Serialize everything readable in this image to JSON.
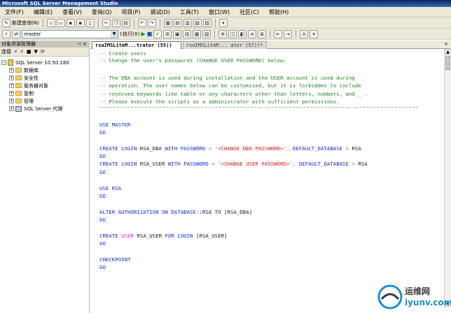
{
  "window": {
    "title": "Microsoft SQL Server Management Studio"
  },
  "menubar": [
    "文件(F)",
    "编辑(E)",
    "查看(V)",
    "查询(Q)",
    "项目(P)",
    "调试(D)",
    "工具(T)",
    "窗口(W)",
    "社区(C)",
    "帮助(H)"
  ],
  "toolbar": {
    "new_query_label": "新建查询(N)",
    "database_value": "master",
    "execute_label": "执行(X)"
  },
  "object_explorer": {
    "title": "对象资源管理器",
    "connect_label": "连接",
    "server_node": "SQL Server 10.50.160",
    "folders": [
      "数据库",
      "安全性",
      "服务器对象",
      "复制",
      "管理"
    ],
    "agent_node": "SQL Server 代理"
  },
  "tabs": {
    "active": "rsaIMSLiteM...trator (55))",
    "inactive": "rsaIMSLiteM... ator (57))*",
    "close_glyph": "×"
  },
  "code": {
    "l1": "-- Create users",
    "l2": "-- Change the user's passwords (CHANGE USER PASSWORD) below.",
    "l3": "-- The DBA account is used during installation and the USER account is used during",
    "l4": "-- operation. The user names below can be customised, but it is forbidden to include",
    "l5": "-- reserved keywords like table or any characters other than letters, numbers, and _ .",
    "l6": "-- Please execute the scripts as a administrator with sufficient permissions.",
    "use1_kw": "USE",
    "use1_db": " MASTER",
    "go": "GO",
    "create": "CREATE",
    "login": "LOGIN",
    "dba_login": "RSA_DBA",
    "with_password": "WITH PASSWORD",
    "eq": " = ",
    "dba_pwd": "'<CHANGE DBA PASSWORD>'",
    "default_db": "DEFAULT_DATABASE",
    "rsa": "RSA",
    "user_login": "RSA_USER",
    "user_pwd": "'<CHANGE USER PASSWORD>'",
    "use2_kw": "USE",
    "use2_db": " RSA",
    "alter": "ALTER AUTHORIZATION ON DATABASE",
    "alter_rest": "::RSA TO ",
    "alter_target": "[RSA_DBA]",
    "user_kw": "USER",
    "for_login": "FOR LOGIN",
    "user_target": "[RSA_USER]",
    "checkpoint": "CHECKPOINT",
    "comma": ", "
  },
  "watermark": {
    "cn": "运维网",
    "url": "iyunv.com"
  }
}
